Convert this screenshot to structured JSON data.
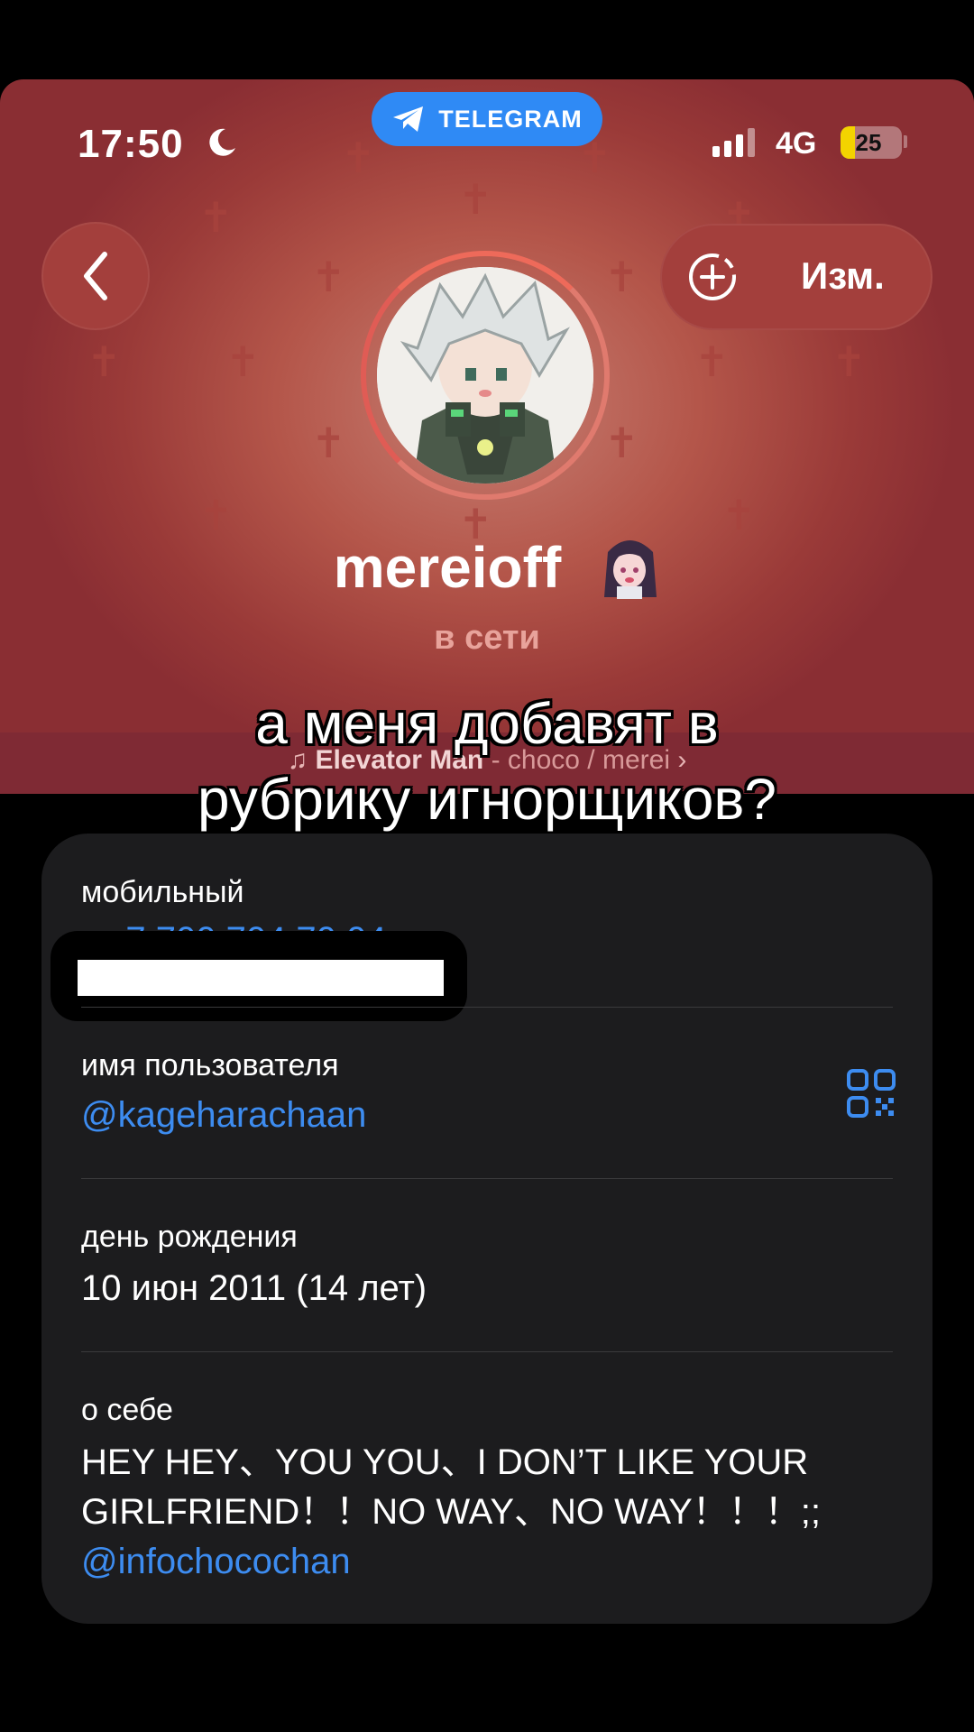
{
  "status_bar": {
    "time": "17:50",
    "app_pill": "TELEGRAM",
    "network": "4G",
    "battery": "25",
    "battery_fraction": 0.25
  },
  "header": {
    "edit_label": "Изм.",
    "name": "mereioff",
    "status": "в сети",
    "music": {
      "title": "Elevator Man",
      "separator": " - ",
      "artist": "choco / merei"
    }
  },
  "caption": {
    "line1": "а меня добавят в",
    "line2": "рубрику игнорщиков?"
  },
  "info": {
    "mobile_label": "мобильный",
    "phone_visible": "+7 700 704 70 04",
    "username_label": "имя пользователя",
    "username": "@kageharachaan",
    "birthday_label": "день рождения",
    "birthday": "10 июн 2011 (14 лет)",
    "about_label": "о себе",
    "about_text": "HEY HEY、YOU YOU、I DON’T LIKE YOUR GIRLFRIEND！！NO WAY、NO WAY！！！;; ",
    "about_link": "@infochocochan"
  },
  "colors": {
    "header_red": "#b4564a",
    "link_blue": "#3d8cf0",
    "telegram_blue": "#2f8af5",
    "card_bg": "#1c1c1e",
    "battery_yellow": "#f3d300"
  },
  "icons": [
    "moon-icon",
    "telegram-plane-icon",
    "signal-icon",
    "battery-icon",
    "back-chevron-icon",
    "add-circle-icon",
    "music-note-icon",
    "chevron-right-icon",
    "qr-code-icon"
  ]
}
